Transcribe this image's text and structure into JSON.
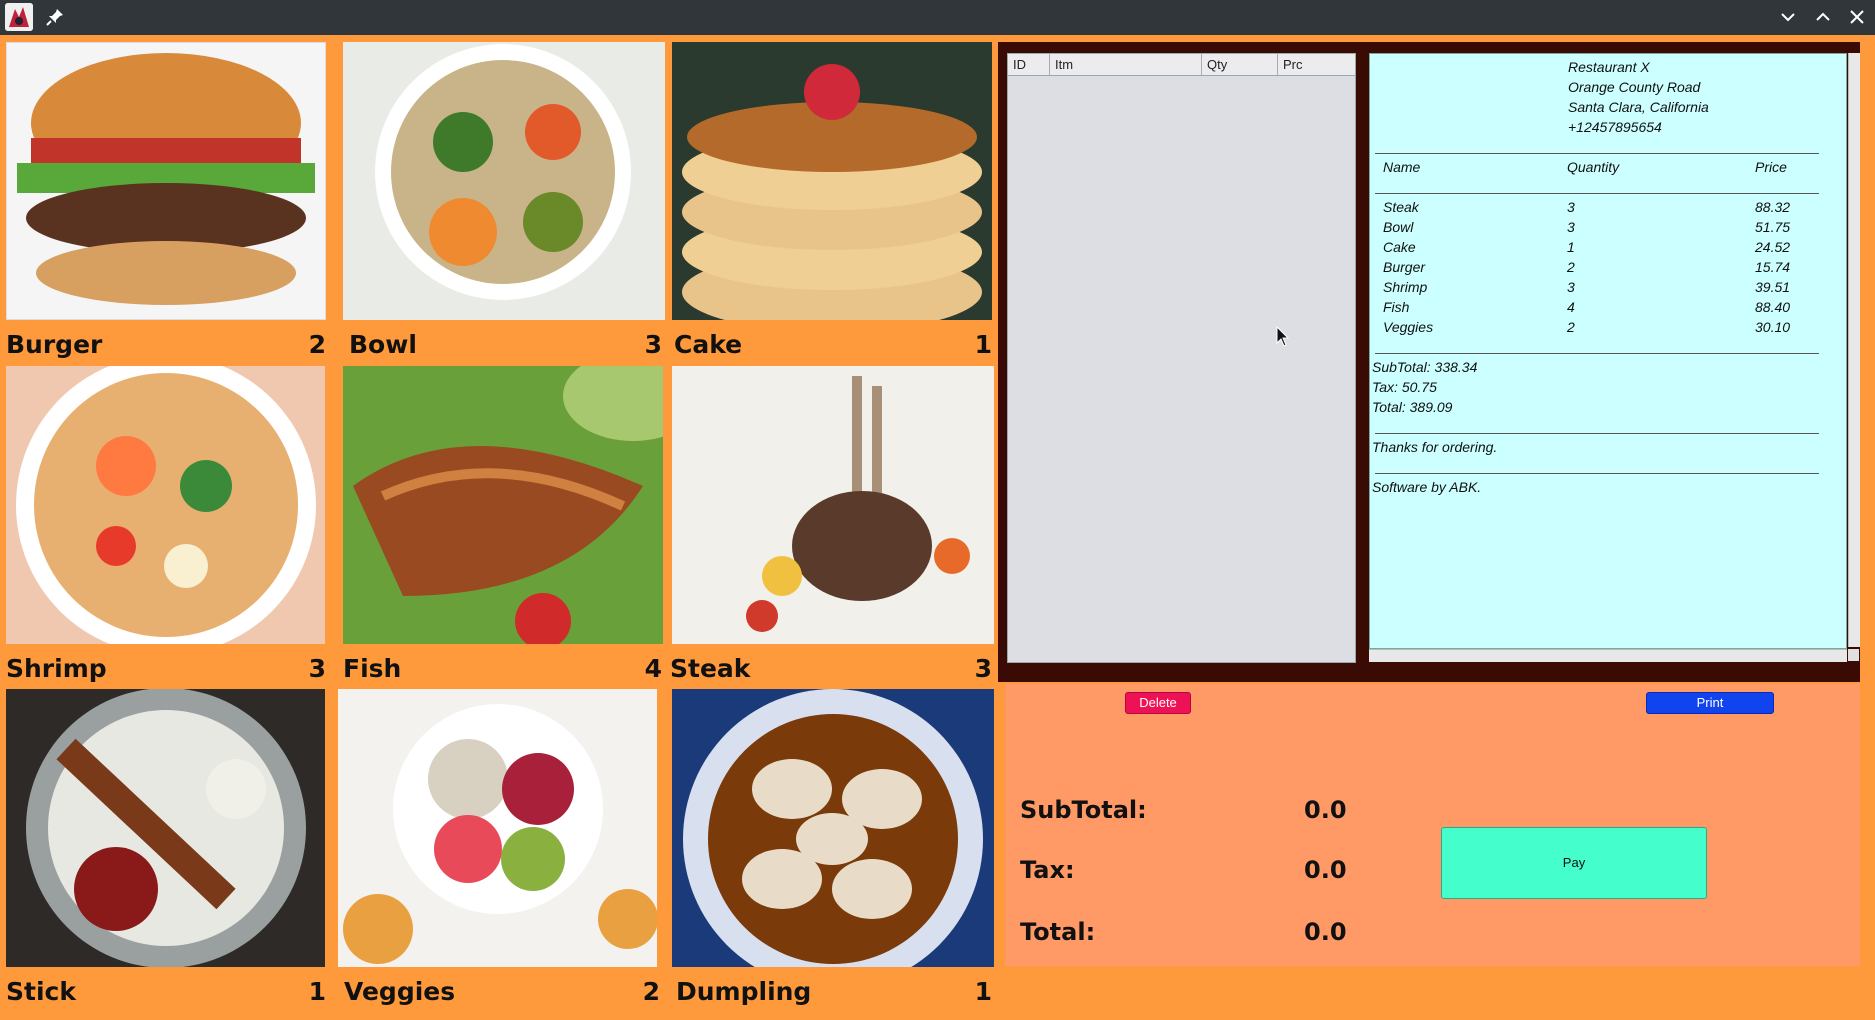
{
  "colors": {
    "background": "#ff9a3c",
    "titlebar": "#31363b",
    "dark_panel": "#3a0a05",
    "receipt_bg": "#ccffff",
    "bottom_panel": "#ff9966",
    "delete_button": "#ee1155",
    "print_button": "#1144ee",
    "pay_button": "#44ffcc"
  },
  "titlebar": {
    "icons": [
      "app-icon",
      "pin-icon",
      "minimize-icon",
      "maximize-icon",
      "close-icon"
    ]
  },
  "menu_items": [
    {
      "name": "Burger",
      "count": "2"
    },
    {
      "name": "Bowl",
      "count": "3"
    },
    {
      "name": "Cake",
      "count": "1"
    },
    {
      "name": "Shrimp",
      "count": "3"
    },
    {
      "name": "Fish",
      "count": "4"
    },
    {
      "name": "Steak",
      "count": "3"
    },
    {
      "name": "Stick",
      "count": "1"
    },
    {
      "name": "Veggies",
      "count": "2"
    },
    {
      "name": "Dumpling",
      "count": "1"
    }
  ],
  "order_table": {
    "columns": [
      "ID",
      "Itm",
      "Qty",
      "Prc"
    ],
    "rows": []
  },
  "receipt": {
    "header": [
      "Restaurant X",
      "Orange County Road",
      "Santa Clara, California",
      "+12457895654"
    ],
    "columns": {
      "name": "Name",
      "quantity": "Quantity",
      "price": "Price"
    },
    "items": [
      {
        "name": "Steak",
        "qty": "3",
        "price": "88.32"
      },
      {
        "name": "Bowl",
        "qty": "3",
        "price": "51.75"
      },
      {
        "name": "Cake",
        "qty": "1",
        "price": "24.52"
      },
      {
        "name": "Burger",
        "qty": "2",
        "price": "15.74"
      },
      {
        "name": "Shrimp",
        "qty": "3",
        "price": "39.51"
      },
      {
        "name": "Fish",
        "qty": "4",
        "price": "88.40"
      },
      {
        "name": "Veggies",
        "qty": "2",
        "price": "30.10"
      }
    ],
    "subtotal": "SubTotal: 338.34",
    "tax": "Tax: 50.75",
    "total": "Total: 389.09",
    "thanks": "Thanks for ordering.",
    "credit": "Software by ABK."
  },
  "buttons": {
    "delete": "Delete",
    "print": "Print",
    "pay": "Pay"
  },
  "totals": {
    "subtotal_label": "SubTotal:",
    "subtotal_value": "0.0",
    "tax_label": "Tax:",
    "tax_value": "0.0",
    "total_label": "Total:",
    "total_value": "0.0"
  }
}
